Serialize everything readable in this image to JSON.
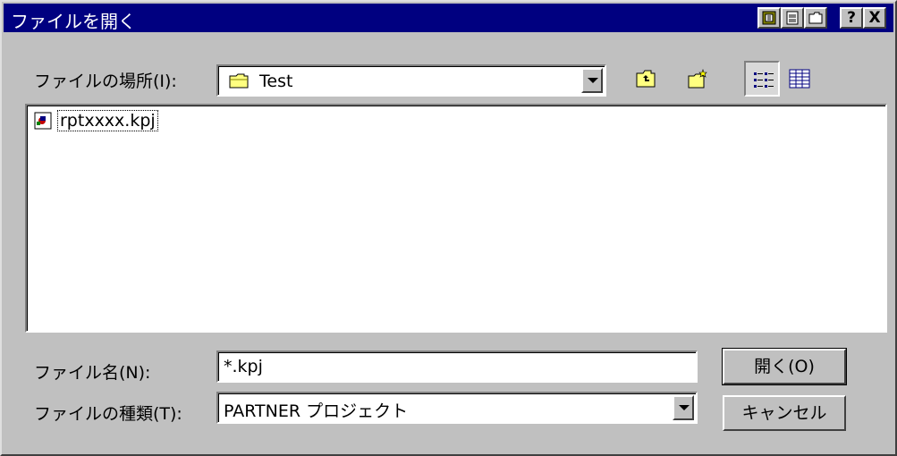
{
  "titlebar": {
    "title": "ファイルを開く",
    "help_label": "?",
    "close_label": "X"
  },
  "location": {
    "label": "ファイルの場所(I):",
    "value": "Test"
  },
  "file_list": {
    "items": [
      {
        "name": "rptxxxx.kpj",
        "icon": "partner-project-file-icon"
      }
    ]
  },
  "filename": {
    "label": "ファイル名(N):",
    "value": "*.kpj"
  },
  "filetype": {
    "label": "ファイルの種類(T):",
    "value": "PARTNER プロジェクト"
  },
  "buttons": {
    "open": "開く(O)",
    "cancel": "キャンセル"
  },
  "colors": {
    "titlebar": "#000080",
    "face": "#c0c0c0",
    "window": "#ffffff"
  }
}
